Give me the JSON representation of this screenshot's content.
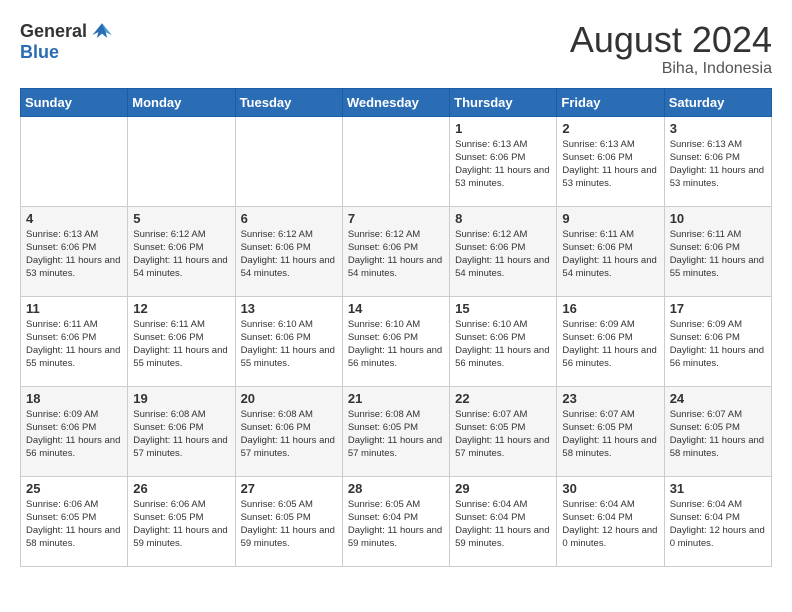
{
  "header": {
    "logo_general": "General",
    "logo_blue": "Blue",
    "month_title": "August 2024",
    "location": "Biha, Indonesia"
  },
  "weekdays": [
    "Sunday",
    "Monday",
    "Tuesday",
    "Wednesday",
    "Thursday",
    "Friday",
    "Saturday"
  ],
  "weeks": [
    [
      {
        "day": "",
        "info": ""
      },
      {
        "day": "",
        "info": ""
      },
      {
        "day": "",
        "info": ""
      },
      {
        "day": "",
        "info": ""
      },
      {
        "day": "1",
        "info": "Sunrise: 6:13 AM\nSunset: 6:06 PM\nDaylight: 11 hours\nand 53 minutes."
      },
      {
        "day": "2",
        "info": "Sunrise: 6:13 AM\nSunset: 6:06 PM\nDaylight: 11 hours\nand 53 minutes."
      },
      {
        "day": "3",
        "info": "Sunrise: 6:13 AM\nSunset: 6:06 PM\nDaylight: 11 hours\nand 53 minutes."
      }
    ],
    [
      {
        "day": "4",
        "info": "Sunrise: 6:13 AM\nSunset: 6:06 PM\nDaylight: 11 hours\nand 53 minutes."
      },
      {
        "day": "5",
        "info": "Sunrise: 6:12 AM\nSunset: 6:06 PM\nDaylight: 11 hours\nand 54 minutes."
      },
      {
        "day": "6",
        "info": "Sunrise: 6:12 AM\nSunset: 6:06 PM\nDaylight: 11 hours\nand 54 minutes."
      },
      {
        "day": "7",
        "info": "Sunrise: 6:12 AM\nSunset: 6:06 PM\nDaylight: 11 hours\nand 54 minutes."
      },
      {
        "day": "8",
        "info": "Sunrise: 6:12 AM\nSunset: 6:06 PM\nDaylight: 11 hours\nand 54 minutes."
      },
      {
        "day": "9",
        "info": "Sunrise: 6:11 AM\nSunset: 6:06 PM\nDaylight: 11 hours\nand 54 minutes."
      },
      {
        "day": "10",
        "info": "Sunrise: 6:11 AM\nSunset: 6:06 PM\nDaylight: 11 hours\nand 55 minutes."
      }
    ],
    [
      {
        "day": "11",
        "info": "Sunrise: 6:11 AM\nSunset: 6:06 PM\nDaylight: 11 hours\nand 55 minutes."
      },
      {
        "day": "12",
        "info": "Sunrise: 6:11 AM\nSunset: 6:06 PM\nDaylight: 11 hours\nand 55 minutes."
      },
      {
        "day": "13",
        "info": "Sunrise: 6:10 AM\nSunset: 6:06 PM\nDaylight: 11 hours\nand 55 minutes."
      },
      {
        "day": "14",
        "info": "Sunrise: 6:10 AM\nSunset: 6:06 PM\nDaylight: 11 hours\nand 56 minutes."
      },
      {
        "day": "15",
        "info": "Sunrise: 6:10 AM\nSunset: 6:06 PM\nDaylight: 11 hours\nand 56 minutes."
      },
      {
        "day": "16",
        "info": "Sunrise: 6:09 AM\nSunset: 6:06 PM\nDaylight: 11 hours\nand 56 minutes."
      },
      {
        "day": "17",
        "info": "Sunrise: 6:09 AM\nSunset: 6:06 PM\nDaylight: 11 hours\nand 56 minutes."
      }
    ],
    [
      {
        "day": "18",
        "info": "Sunrise: 6:09 AM\nSunset: 6:06 PM\nDaylight: 11 hours\nand 56 minutes."
      },
      {
        "day": "19",
        "info": "Sunrise: 6:08 AM\nSunset: 6:06 PM\nDaylight: 11 hours\nand 57 minutes."
      },
      {
        "day": "20",
        "info": "Sunrise: 6:08 AM\nSunset: 6:06 PM\nDaylight: 11 hours\nand 57 minutes."
      },
      {
        "day": "21",
        "info": "Sunrise: 6:08 AM\nSunset: 6:05 PM\nDaylight: 11 hours\nand 57 minutes."
      },
      {
        "day": "22",
        "info": "Sunrise: 6:07 AM\nSunset: 6:05 PM\nDaylight: 11 hours\nand 57 minutes."
      },
      {
        "day": "23",
        "info": "Sunrise: 6:07 AM\nSunset: 6:05 PM\nDaylight: 11 hours\nand 58 minutes."
      },
      {
        "day": "24",
        "info": "Sunrise: 6:07 AM\nSunset: 6:05 PM\nDaylight: 11 hours\nand 58 minutes."
      }
    ],
    [
      {
        "day": "25",
        "info": "Sunrise: 6:06 AM\nSunset: 6:05 PM\nDaylight: 11 hours\nand 58 minutes."
      },
      {
        "day": "26",
        "info": "Sunrise: 6:06 AM\nSunset: 6:05 PM\nDaylight: 11 hours\nand 59 minutes."
      },
      {
        "day": "27",
        "info": "Sunrise: 6:05 AM\nSunset: 6:05 PM\nDaylight: 11 hours\nand 59 minutes."
      },
      {
        "day": "28",
        "info": "Sunrise: 6:05 AM\nSunset: 6:04 PM\nDaylight: 11 hours\nand 59 minutes."
      },
      {
        "day": "29",
        "info": "Sunrise: 6:04 AM\nSunset: 6:04 PM\nDaylight: 11 hours\nand 59 minutes."
      },
      {
        "day": "30",
        "info": "Sunrise: 6:04 AM\nSunset: 6:04 PM\nDaylight: 12 hours\nand 0 minutes."
      },
      {
        "day": "31",
        "info": "Sunrise: 6:04 AM\nSunset: 6:04 PM\nDaylight: 12 hours\nand 0 minutes."
      }
    ]
  ]
}
